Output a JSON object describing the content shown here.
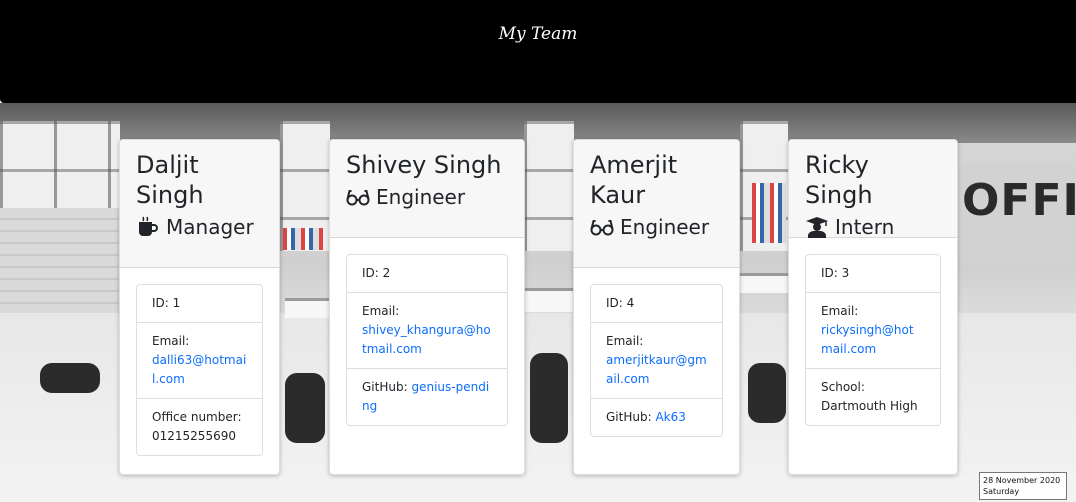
{
  "header": {
    "title": "My Team"
  },
  "background": {
    "office_sign": "OFFIC"
  },
  "cards": [
    {
      "name": "Daljit Singh",
      "role": "Manager",
      "role_icon": "mug-icon",
      "id": "ID: 1",
      "email_label": "Email:",
      "email": "dalli63@hotmail.com",
      "extra_label": "Office number:",
      "extra_value": "01215255690"
    },
    {
      "name": "Shivey Singh",
      "role": "Engineer",
      "role_icon": "glasses-icon",
      "id": "ID: 2",
      "email_label": "Email:",
      "email": "shivey_khangura@hotmail.com",
      "extra_label": "GitHub:",
      "extra_value": "genius-pending"
    },
    {
      "name": "Amerjit Kaur",
      "role": "Engineer",
      "role_icon": "glasses-icon",
      "id": "ID: 4",
      "email_label": "Email:",
      "email": "amerjitkaur@gmail.com",
      "extra_label": "GitHub:",
      "extra_value": "Ak63"
    },
    {
      "name": "Ricky Singh",
      "role": "Intern",
      "role_icon": "graduate-icon",
      "id": "ID: 3",
      "email_label": "Email:",
      "email": "rickysingh@hotmail.com",
      "extra_label": "School:",
      "extra_value": "Dartmouth High"
    }
  ],
  "taskbar_clock": {
    "date": "28 November 2020",
    "day": "Saturday"
  },
  "colors": {
    "header_bg": "#000000",
    "link": "#0d6efd",
    "card_header_bg": "#f7f7f7"
  }
}
